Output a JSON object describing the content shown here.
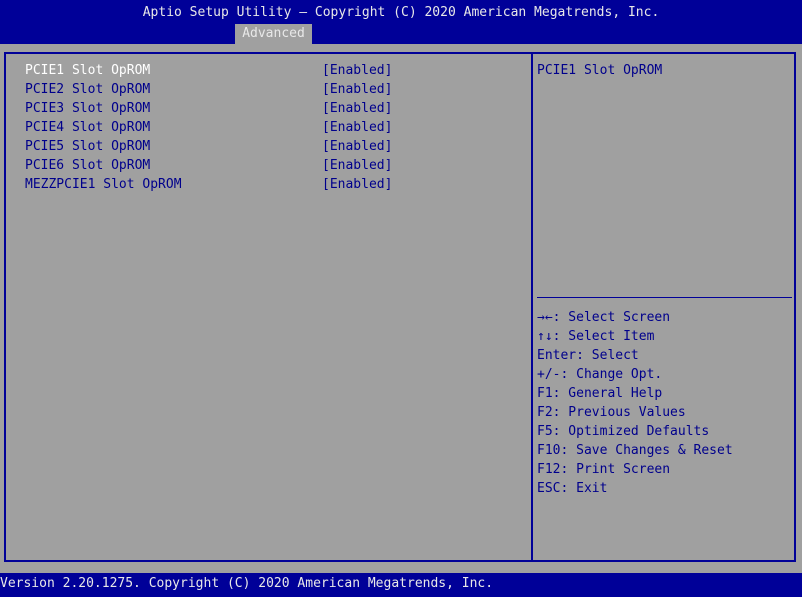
{
  "header": {
    "title": "Aptio Setup Utility – Copyright (C) 2020 American Megatrends, Inc.",
    "active_tab": "Advanced"
  },
  "settings": [
    {
      "label": "PCIE1 Slot OpROM",
      "value": "[Enabled]",
      "selected": true
    },
    {
      "label": "PCIE2 Slot OpROM",
      "value": "[Enabled]",
      "selected": false
    },
    {
      "label": "PCIE3 Slot OpROM",
      "value": "[Enabled]",
      "selected": false
    },
    {
      "label": "PCIE4 Slot OpROM",
      "value": "[Enabled]",
      "selected": false
    },
    {
      "label": "PCIE5 Slot OpROM",
      "value": "[Enabled]",
      "selected": false
    },
    {
      "label": "PCIE6 Slot OpROM",
      "value": "[Enabled]",
      "selected": false
    },
    {
      "label": "MEZZPCIE1 Slot OpROM",
      "value": "[Enabled]",
      "selected": false
    }
  ],
  "help": {
    "text": "PCIE1 Slot OpROM"
  },
  "keys": [
    "→←: Select Screen",
    "↑↓: Select Item",
    "Enter: Select",
    "+/-: Change Opt.",
    "F1: General Help",
    "F2: Previous Values",
    "F5: Optimized Defaults",
    "F10: Save Changes & Reset",
    "F12: Print Screen",
    "ESC: Exit"
  ],
  "footer": {
    "text": "Version 2.20.1275. Copyright (C) 2020 American Megatrends, Inc."
  },
  "colors": {
    "background": "#a0a0a0",
    "bar": "#000098",
    "text": "#00008c",
    "highlight": "#ffffff"
  }
}
